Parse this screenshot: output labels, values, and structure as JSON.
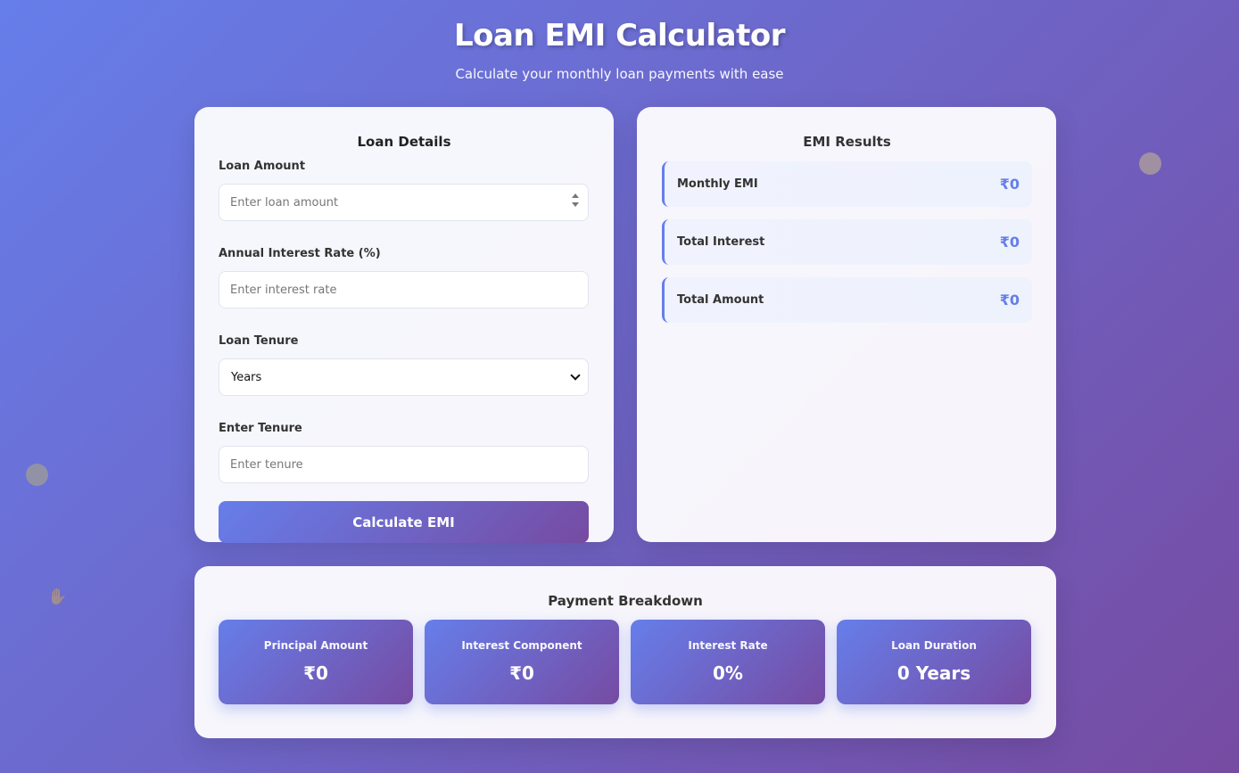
{
  "header": {
    "title": "Loan EMI Calculator",
    "subtitle": "Calculate your monthly loan payments with ease"
  },
  "loan_details": {
    "title": "Loan Details",
    "loan_amount": {
      "label": "Loan Amount",
      "placeholder": "Enter loan amount",
      "value": ""
    },
    "interest_rate": {
      "label": "Annual Interest Rate (%)",
      "placeholder": "Enter interest rate",
      "value": ""
    },
    "tenure_type": {
      "label": "Loan Tenure",
      "selected": "Years"
    },
    "tenure": {
      "label": "Enter Tenure",
      "placeholder": "Enter tenure",
      "value": ""
    },
    "calculate_label": "Calculate EMI"
  },
  "emi_results": {
    "title": "EMI Results",
    "items": [
      {
        "label": "Monthly EMI",
        "value": "₹0"
      },
      {
        "label": "Total Interest",
        "value": "₹0"
      },
      {
        "label": "Total Amount",
        "value": "₹0"
      }
    ]
  },
  "payment_breakdown": {
    "title": "Payment Breakdown",
    "items": [
      {
        "label": "Principal Amount",
        "value": "₹0"
      },
      {
        "label": "Interest Component",
        "value": "₹0"
      },
      {
        "label": "Interest Rate",
        "value": "0%"
      },
      {
        "label": "Loan Duration",
        "value": "0 Years"
      }
    ]
  },
  "decorations": {
    "floating_icon": "hand-icon",
    "accent_color": "#667eea",
    "gradient_end": "#764ba2"
  }
}
